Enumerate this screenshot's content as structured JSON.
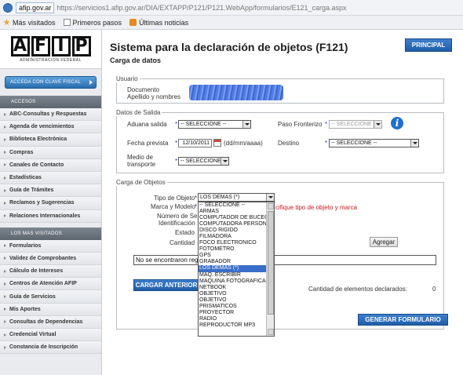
{
  "browser": {
    "domain": "afip.gov.ar",
    "url": "https://servicios1.afip.gov.ar/DIA/EXTAPP/P121/P121.WebApp/formularios/E121_carga.aspx",
    "bookmarks": [
      "Más visitados",
      "Primeros pasos",
      "Últimas noticias"
    ]
  },
  "sidebar": {
    "logo_letters": [
      "A",
      "F",
      "I",
      "P"
    ],
    "logo_sub": "ADMINISTRACION FEDERAL",
    "clave_fiscal_button": "ACCEDA CON CLAVE FISCAL",
    "accesos_header": "ACCESOS",
    "accesos": [
      "ABC-Consultas y Respuestas",
      "Agenda de vencimientos",
      "Biblioteca Electrónica",
      "Compras",
      "Canales de Contacto",
      "Estadísticas",
      "Guía de Trámites",
      "Reclamos y Sugerencias",
      "Relaciones Internacionales"
    ],
    "mas_visitados_header": "LOS MAS VISITADOS",
    "mas_visitados": [
      "Formularios",
      "Validez de Comprobantes",
      "Cálculo de Intereses",
      "Centros de Atención AFIP",
      "Guía de Servicios",
      "Mis Aportes",
      "Consultas de Dependencias",
      "Credencial Virtual",
      "Constancia de Inscripción"
    ]
  },
  "main": {
    "title": "Sistema para la declaración de objetos (F121)",
    "subtitle": "Carga de datos",
    "principal_button": "PRINCIPAL",
    "usuario": {
      "legend": "Usuario",
      "documento_label": "Documento",
      "apellido_label": "Apellido y nombres"
    },
    "salida": {
      "legend": "Datos de Salida",
      "aduana_label": "Aduana salida",
      "aduana_value": "-- SELECCIONE --",
      "paso_label": "Paso Fronterizo",
      "paso_value": "-- SELECCIONE --",
      "fecha_label": "Fecha prevista",
      "fecha_value": "12/10/2011",
      "fecha_format": "(dd/mm/aaaa)",
      "destino_label": "Destino",
      "destino_value": "-- SELECCIONE --",
      "medio_label_1": "Medio de",
      "medio_label_2": "transporte",
      "medio_value": "-- SELECCIONE --"
    },
    "carga": {
      "legend": "Carga de Objetos",
      "tipo_label": "Tipo de Objeto",
      "tipo_value": "LOS DEMAS (*)",
      "marca_label": "Marca y Modelo",
      "serie_label_1": "Número de Serie /",
      "serie_label_2": "Identificación",
      "estado_label": "Estado",
      "cantidad_label": "Cantidad",
      "hint": "cifique tipo de objeto y marca",
      "agregar_button": "Agregar",
      "no_records": "No se encontraron reg",
      "cargar_button": "CARGAR ANTERIOR",
      "count_label": "Cantidad de elementos declarados:",
      "count_value": "0",
      "options": [
        "-- SELECCIONE --",
        "ARMAS",
        "COMPUTADOR DE BUCEO",
        "COMPUTADORA PERSONAL",
        "DISCO RIGIDO",
        "FILMADORA",
        "FOCO ELECTRONICO",
        "FOTOMETRO",
        "GPS",
        "GRABADOR",
        "LOS DEMAS (*)",
        "MAQ. ESCRIBIR",
        "MAQUINA FOTOGRAFICA",
        "NETBOOK",
        "OBJETIVO",
        "OBJETIVO",
        "PRISMATICOS",
        "PROYECTOR",
        "RADIO",
        "REPRODUCTOR MP3"
      ],
      "selected_index": 10
    },
    "generar_button": "GENERAR FORMULARIO"
  }
}
